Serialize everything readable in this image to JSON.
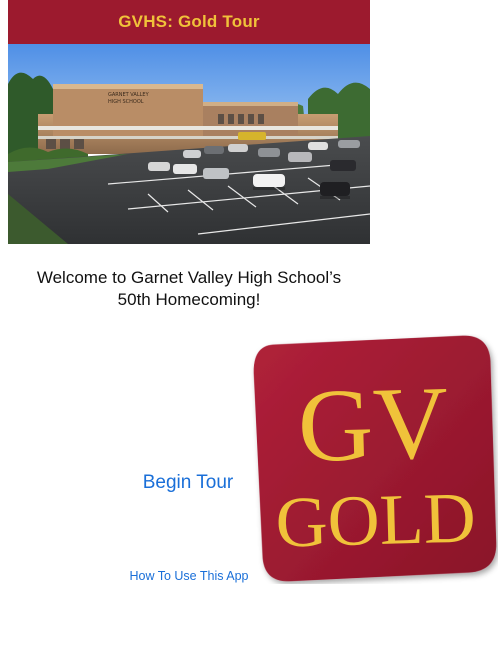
{
  "header": {
    "title": "GVHS: Gold Tour",
    "bg_color": "#9c1a2e",
    "title_color": "#f0c23a"
  },
  "hero": {
    "sign_line1": "GARNET VALLEY",
    "sign_line2": "HIGH SCHOOL"
  },
  "welcome": {
    "line1": "Welcome to Garnet Valley High School’s",
    "line2": "50th Homecoming!"
  },
  "actions": {
    "begin_tour_label": "Begin Tour",
    "how_to_label": "How To Use This App",
    "link_color": "#1a6fd8"
  },
  "logo": {
    "line1": "GV",
    "line2": "GOLD",
    "bg_color": "#9c1a2e",
    "text_color": "#f0c23a"
  }
}
